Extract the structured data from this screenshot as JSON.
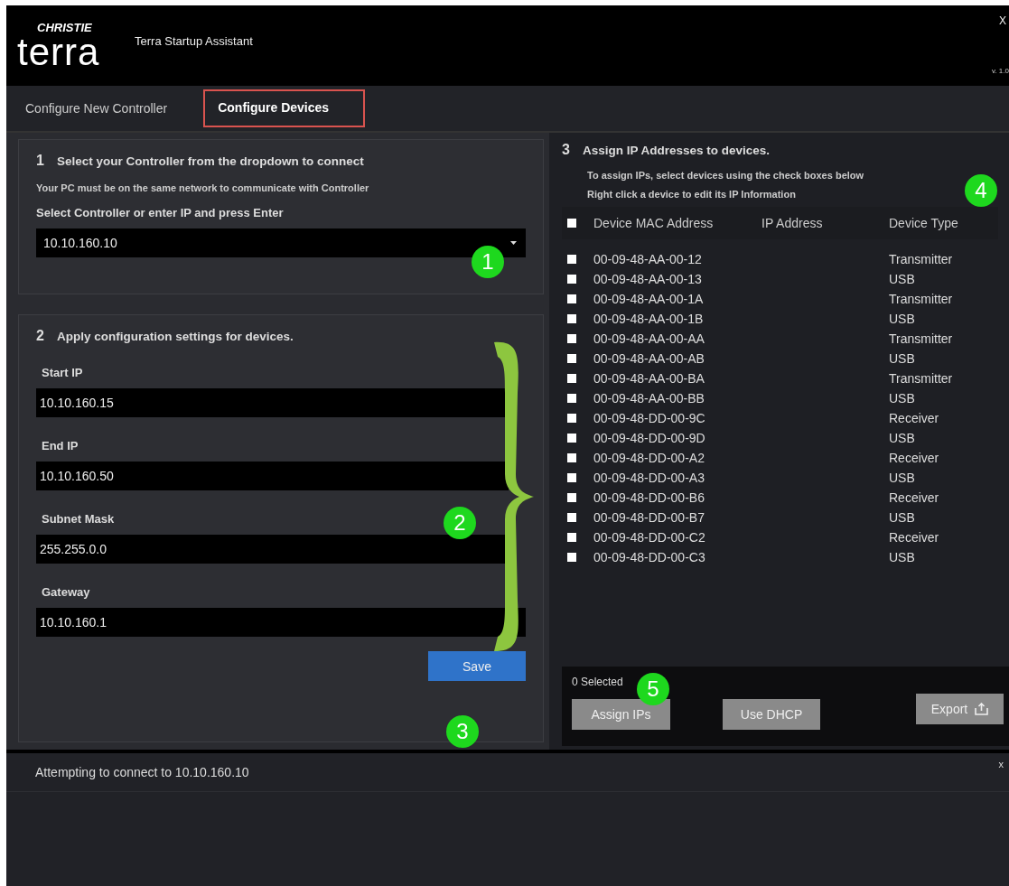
{
  "window": {
    "brand": "CHRISTIE",
    "logo": "terra",
    "title": "Terra Startup Assistant",
    "close": "X",
    "version": "v. 1.0"
  },
  "tabs": [
    {
      "label": "Configure New Controller",
      "selected": false
    },
    {
      "label": "Configure Devices",
      "selected": true
    }
  ],
  "controller_panel": {
    "number": "1",
    "title": "Select your Controller from the dropdown to connect",
    "note": "Your PC must be on the same network to communicate with Controller",
    "field_label": "Select Controller or enter IP and press Enter",
    "value": "10.10.160.10"
  },
  "config_panel": {
    "number": "2",
    "title": "Apply configuration settings for devices.",
    "fields": [
      {
        "label": "Start IP",
        "value": "10.10.160.15"
      },
      {
        "label": "End IP",
        "value": "10.10.160.50"
      },
      {
        "label": "Subnet Mask",
        "value": "255.255.0.0"
      },
      {
        "label": "Gateway",
        "value": "10.10.160.1"
      }
    ],
    "save": "Save"
  },
  "assign_panel": {
    "number": "3",
    "title": "Assign IP Addresses to devices.",
    "hints": [
      "To assign IPs, select devices using the check boxes below",
      "Right click a device to edit its IP Information"
    ],
    "table": {
      "all_checked": false,
      "columns": [
        "Device MAC Address",
        "IP Address",
        "Device Type"
      ],
      "rows": [
        {
          "checked": false,
          "mac": "00-09-48-AA-00-12",
          "type": "Transmitter"
        },
        {
          "checked": false,
          "mac": "00-09-48-AA-00-13",
          "type": "USB"
        },
        {
          "checked": false,
          "mac": "00-09-48-AA-00-1A",
          "type": "Transmitter"
        },
        {
          "checked": false,
          "mac": "00-09-48-AA-00-1B",
          "type": "USB"
        },
        {
          "checked": false,
          "mac": "00-09-48-AA-00-AA",
          "type": "Transmitter"
        },
        {
          "checked": false,
          "mac": "00-09-48-AA-00-AB",
          "type": "USB"
        },
        {
          "checked": false,
          "mac": "00-09-48-AA-00-BA",
          "type": "Transmitter"
        },
        {
          "checked": false,
          "mac": "00-09-48-AA-00-BB",
          "type": "USB"
        },
        {
          "checked": false,
          "mac": "00-09-48-DD-00-9C",
          "type": "Receiver"
        },
        {
          "checked": false,
          "mac": "00-09-48-DD-00-9D",
          "type": "USB"
        },
        {
          "checked": false,
          "mac": "00-09-48-DD-00-A2",
          "type": "Receiver"
        },
        {
          "checked": false,
          "mac": "00-09-48-DD-00-A3",
          "type": "USB"
        },
        {
          "checked": false,
          "mac": "00-09-48-DD-00-B6",
          "type": "Receiver"
        },
        {
          "checked": false,
          "mac": "00-09-48-DD-00-B7",
          "type": "USB"
        },
        {
          "checked": false,
          "mac": "00-09-48-DD-00-C2",
          "type": "Receiver"
        },
        {
          "checked": false,
          "mac": "00-09-48-DD-00-C3",
          "type": "USB"
        }
      ]
    },
    "selected_count": "0 Selected",
    "buttons": [
      "Assign IPs",
      "Use DHCP"
    ],
    "export": "Export"
  },
  "status": {
    "message": "Attempting to connect to 10.10.160.10",
    "close": "x"
  },
  "callouts": [
    {
      "label": "1"
    },
    {
      "label": "2"
    },
    {
      "label": "3"
    },
    {
      "label": "4"
    },
    {
      "label": "5"
    }
  ]
}
